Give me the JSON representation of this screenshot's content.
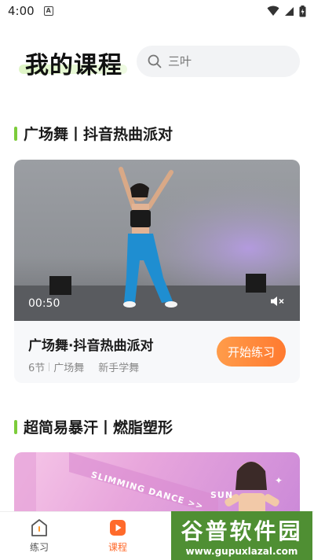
{
  "status_bar": {
    "time": "4:00",
    "app_icon": "A"
  },
  "header": {
    "title": "我的课程"
  },
  "search": {
    "placeholder": "三叶"
  },
  "sections": [
    {
      "title": "广场舞丨抖音热曲派对"
    },
    {
      "title": "超简易暴汗丨燃脂塑形"
    }
  ],
  "course": {
    "video_time": "00:50",
    "name": "广场舞·抖音热曲派对",
    "lessons": "6节",
    "category": "广场舞",
    "tag": "新手学舞",
    "start_label": "开始练习"
  },
  "banner": {
    "text": "SLIMMING DANCE >>",
    "side_text": "SUN"
  },
  "tabs": [
    {
      "label": "练习",
      "icon": "practice-icon",
      "active": false
    },
    {
      "label": "课程",
      "icon": "course-icon",
      "active": true
    }
  ],
  "watermark": {
    "main": "谷普软件园",
    "url": "www.gupuxlazal.com"
  },
  "colors": {
    "accent_green": "#7ccc3a",
    "button_orange": "#ff7a30",
    "active_tab": "#ff6a2b"
  }
}
